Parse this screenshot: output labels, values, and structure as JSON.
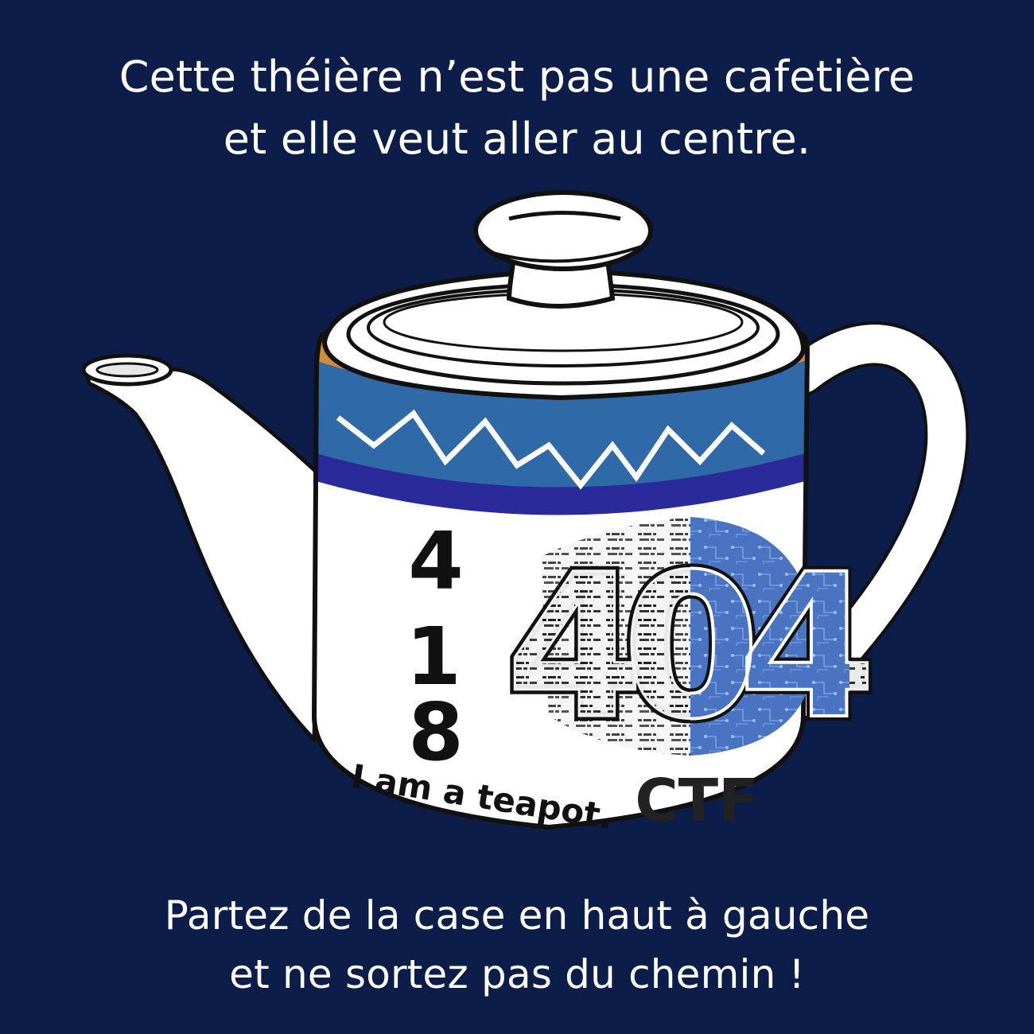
{
  "headline_top": {
    "line1": "Cette théière n’est pas une cafetière",
    "line2": "et elle veut aller au centre."
  },
  "headline_bottom": {
    "line1": "Partez de la case en haut à gauche",
    "line2": "et ne sortez pas du chemin !"
  },
  "teapot": {
    "digit1": "4",
    "digit2": "1",
    "digit3": "8",
    "slogan": "I am a teapot.",
    "logo_digits": "404",
    "logo_label": "CTF"
  },
  "colors": {
    "background": "#0d1d49",
    "band_orange": "#d38a3a",
    "band_blue": "#2f69a8",
    "band_indigo": "#2a2a9a",
    "logo_blue": "#4a73c1"
  },
  "icons": {
    "teapot": "teapot-illustration",
    "logo": "404-ctf-logo"
  }
}
